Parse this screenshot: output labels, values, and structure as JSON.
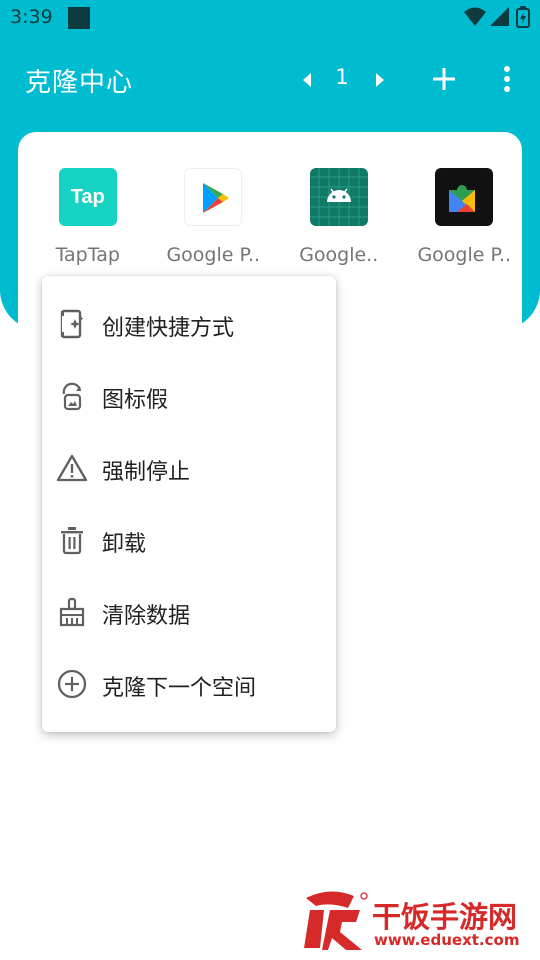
{
  "status_bar": {
    "time": "3:39"
  },
  "app_bar": {
    "title": "克隆中心",
    "page_number": "1"
  },
  "apps": [
    {
      "label": "TapTap",
      "icon": "taptap-icon",
      "icon_text": "Tap"
    },
    {
      "label": "Google P..",
      "icon": "google-play-icon"
    },
    {
      "label": "Google..",
      "icon": "android-icon"
    },
    {
      "label": "Google P..",
      "icon": "google-play-services-icon"
    }
  ],
  "menu": {
    "items": [
      {
        "label": "创建快捷方式",
        "icon": "shortcut-icon"
      },
      {
        "label": "图标假",
        "icon": "fake-icon-icon"
      },
      {
        "label": "强制停止",
        "icon": "warning-icon"
      },
      {
        "label": "卸载",
        "icon": "trash-icon"
      },
      {
        "label": "清除数据",
        "icon": "brush-icon"
      },
      {
        "label": "克隆下一个空间",
        "icon": "add-circle-icon"
      }
    ]
  },
  "watermark": {
    "title": "干饭手游网",
    "url": "www.eduext.com"
  },
  "colors": {
    "primary": "#00bcd0",
    "menu_text": "#212121",
    "app_label": "#757575",
    "watermark": "#d62a2a"
  }
}
